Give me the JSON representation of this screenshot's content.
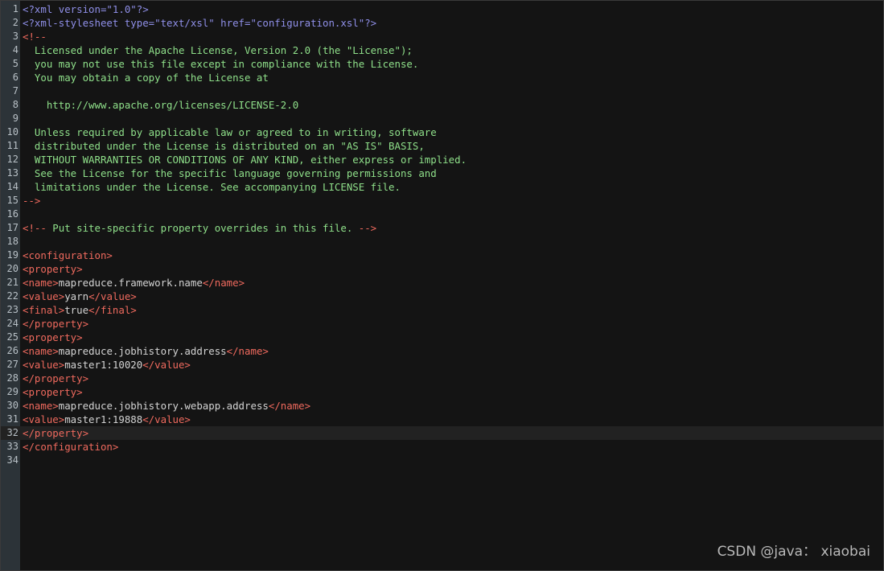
{
  "editor": {
    "active_line": 32,
    "lines": [
      {
        "n": "1",
        "segs": [
          {
            "c": "pi",
            "t": "<?xml version=\"1.0\"?>"
          }
        ]
      },
      {
        "n": "2",
        "segs": [
          {
            "c": "pi",
            "t": "<?xml-stylesheet type=\"text/xsl\" href=\"configuration.xsl\"?>"
          }
        ]
      },
      {
        "n": "3",
        "segs": [
          {
            "c": "cm",
            "t": "<!--"
          }
        ]
      },
      {
        "n": "4",
        "segs": [
          {
            "c": "ct",
            "t": "  Licensed under the Apache License, Version 2.0 (the \"License\");"
          }
        ]
      },
      {
        "n": "5",
        "segs": [
          {
            "c": "ct",
            "t": "  you may not use this file except in compliance with the License."
          }
        ]
      },
      {
        "n": "6",
        "segs": [
          {
            "c": "ct",
            "t": "  You may obtain a copy of the License at"
          }
        ]
      },
      {
        "n": "7",
        "segs": []
      },
      {
        "n": "8",
        "segs": [
          {
            "c": "ct",
            "t": "    http://www.apache.org/licenses/LICENSE-2.0"
          }
        ]
      },
      {
        "n": "9",
        "segs": []
      },
      {
        "n": "10",
        "segs": [
          {
            "c": "ct",
            "t": "  Unless required by applicable law or agreed to in writing, software"
          }
        ]
      },
      {
        "n": "11",
        "segs": [
          {
            "c": "ct",
            "t": "  distributed under the License is distributed on an \"AS IS\" BASIS,"
          }
        ]
      },
      {
        "n": "12",
        "segs": [
          {
            "c": "ct",
            "t": "  WITHOUT WARRANTIES OR CONDITIONS OF ANY KIND, either express or implied."
          }
        ]
      },
      {
        "n": "13",
        "segs": [
          {
            "c": "ct",
            "t": "  See the License for the specific language governing permissions and"
          }
        ]
      },
      {
        "n": "14",
        "segs": [
          {
            "c": "ct",
            "t": "  limitations under the License. See accompanying LICENSE file."
          }
        ]
      },
      {
        "n": "15",
        "segs": [
          {
            "c": "cm",
            "t": "-->"
          }
        ]
      },
      {
        "n": "16",
        "segs": []
      },
      {
        "n": "17",
        "segs": [
          {
            "c": "cm",
            "t": "<!--"
          },
          {
            "c": "ct",
            "t": " Put site-specific property overrides in this file. "
          },
          {
            "c": "cm",
            "t": "-->"
          }
        ]
      },
      {
        "n": "18",
        "segs": []
      },
      {
        "n": "19",
        "segs": [
          {
            "c": "tag",
            "t": "<configuration>"
          }
        ]
      },
      {
        "n": "20",
        "segs": [
          {
            "c": "tag",
            "t": "<property>"
          }
        ]
      },
      {
        "n": "21",
        "segs": [
          {
            "c": "tag",
            "t": "<name>"
          },
          {
            "c": "txt",
            "t": "mapreduce.framework.name"
          },
          {
            "c": "tag",
            "t": "</name>"
          }
        ]
      },
      {
        "n": "22",
        "segs": [
          {
            "c": "tag",
            "t": "<value>"
          },
          {
            "c": "txt",
            "t": "yarn"
          },
          {
            "c": "tag",
            "t": "</value>"
          }
        ]
      },
      {
        "n": "23",
        "segs": [
          {
            "c": "tag",
            "t": "<final>"
          },
          {
            "c": "txt",
            "t": "true"
          },
          {
            "c": "tag",
            "t": "</final>"
          }
        ]
      },
      {
        "n": "24",
        "segs": [
          {
            "c": "tag",
            "t": "</property>"
          }
        ]
      },
      {
        "n": "25",
        "segs": [
          {
            "c": "tag",
            "t": "<property>"
          }
        ]
      },
      {
        "n": "26",
        "segs": [
          {
            "c": "tag",
            "t": "<name>"
          },
          {
            "c": "txt",
            "t": "mapreduce.jobhistory.address"
          },
          {
            "c": "tag",
            "t": "</name>"
          }
        ]
      },
      {
        "n": "27",
        "segs": [
          {
            "c": "tag",
            "t": "<value>"
          },
          {
            "c": "txt",
            "t": "master1:10020"
          },
          {
            "c": "tag",
            "t": "</value>"
          }
        ]
      },
      {
        "n": "28",
        "segs": [
          {
            "c": "tag",
            "t": "</property>"
          }
        ]
      },
      {
        "n": "29",
        "segs": [
          {
            "c": "tag",
            "t": "<property>"
          }
        ]
      },
      {
        "n": "30",
        "segs": [
          {
            "c": "tag",
            "t": "<name>"
          },
          {
            "c": "txt",
            "t": "mapreduce.jobhistory.webapp.address"
          },
          {
            "c": "tag",
            "t": "</name>"
          }
        ]
      },
      {
        "n": "31",
        "segs": [
          {
            "c": "tag",
            "t": "<value>"
          },
          {
            "c": "txt",
            "t": "master1:19888"
          },
          {
            "c": "tag",
            "t": "</value>"
          }
        ]
      },
      {
        "n": "32",
        "segs": [
          {
            "c": "tag",
            "t": "</property>"
          }
        ]
      },
      {
        "n": "33",
        "segs": [
          {
            "c": "tag",
            "t": "</configuration>"
          }
        ]
      },
      {
        "n": "34",
        "segs": []
      }
    ]
  },
  "colors": {
    "background": "#141414",
    "gutter": "#2c3338",
    "processing_instruction": "#8f8fe8",
    "comment_delimiter": "#f06a5e",
    "comment_text": "#8fe08a",
    "tag": "#f06a5e",
    "text": "#d4d4d4"
  },
  "watermark": "CSDN @java： xiaobai"
}
